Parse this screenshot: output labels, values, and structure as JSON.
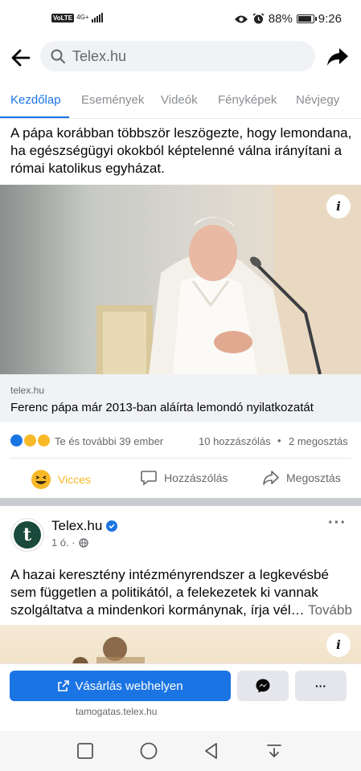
{
  "status_bar": {
    "volte": "VoLTE",
    "network": "4G+",
    "battery": "88%",
    "battery_level": 0.88,
    "time": "9:26"
  },
  "top_bar": {
    "back_icon": "arrow-left-icon",
    "search_icon": "search-icon",
    "search_text": "Telex.hu",
    "share_icon": "share-arrow-icon"
  },
  "tabs": [
    {
      "label": "Kezdőlap",
      "active": true
    },
    {
      "label": "Események",
      "active": false
    },
    {
      "label": "Videók",
      "active": false
    },
    {
      "label": "Fényképek",
      "active": false
    },
    {
      "label": "Névjegy",
      "active": false
    }
  ],
  "post1": {
    "text": "A pápa korábban többször leszögezte, hogy lemondana, ha egészségügyi okokból képtelenné válna irányítani a római katolikus egyházat.",
    "link_domain": "telex.hu",
    "link_title": "Ferenc pápa már 2013-ban aláírta lemondó nyilatkozatát",
    "reactions_text": "Te és további 39 ember",
    "comments": "10 hozzászólás",
    "dot": "•",
    "shares": "2 megosztás",
    "actions": {
      "react": "Vicces",
      "comment": "Hozzászólás",
      "share": "Megosztás"
    }
  },
  "post2": {
    "page_name": "Telex.hu",
    "avatar_letter": "t",
    "time": "1 ó. ·",
    "more": "···",
    "text": "A hazai keresztény intézményrendszer a legkevésbé sem független a politikától, a felekezetek ki vannak szolgáltatva a mindenkori kormánynak, írja vél…",
    "see_more": "Tovább"
  },
  "cta": {
    "main_label": "Vásárlás webhelyen",
    "more_label": "···",
    "url": "tamogatas.telex.hu"
  },
  "colors": {
    "accent": "#1b74e4",
    "haha": "#f7b928",
    "text_secondary": "#65676b"
  }
}
